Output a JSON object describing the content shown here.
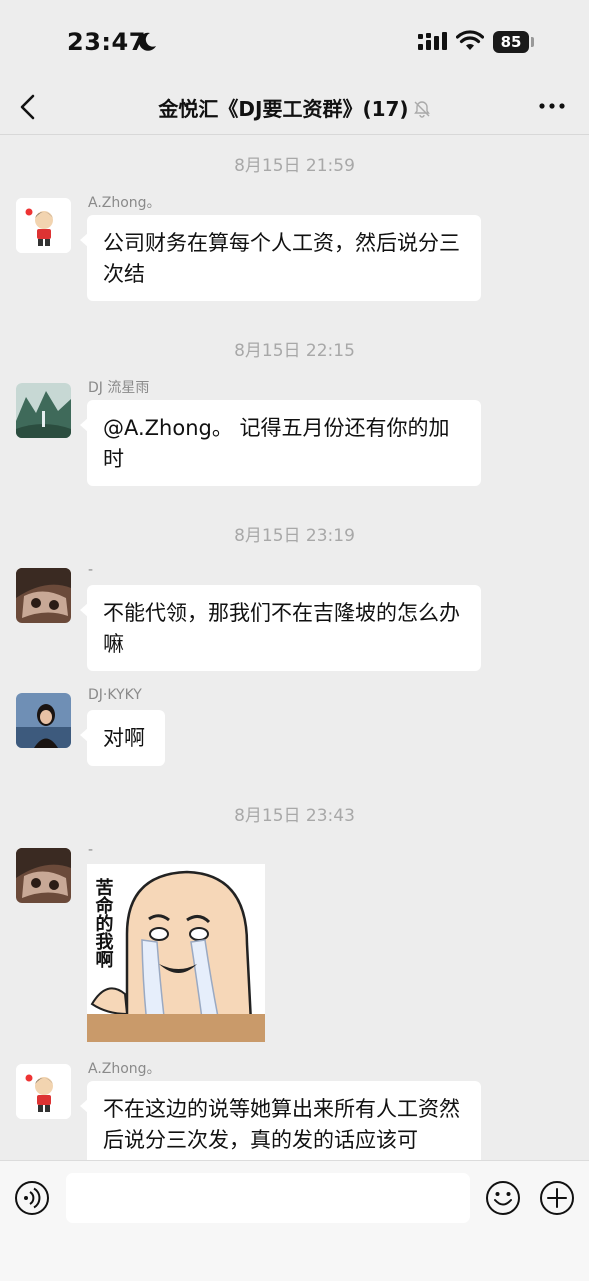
{
  "status_bar": {
    "time": "23:47",
    "battery": "85"
  },
  "header": {
    "title": "金悦汇《DJ要工资群》(17)"
  },
  "messages": [
    {
      "timestamp": "8月15日 21:59",
      "sender": "A.Zhong。",
      "text": "公司财务在算每个人工资，然后说分三次结"
    },
    {
      "timestamp": "8月15日 22:15",
      "sender": "DJ 流星雨",
      "text": "@A.Zhong。 记得五月份还有你的加时"
    },
    {
      "timestamp": "8月15日 23:19",
      "sender": "-",
      "text": "不能代领，那我们不在吉隆坡的怎么办嘛"
    },
    {
      "sender": "DJ·KYKY",
      "text": "对啊"
    },
    {
      "timestamp": "8月15日 23:43",
      "sender": "-",
      "sticker_text": "苦命的我啊"
    },
    {
      "sender": "A.Zhong。",
      "text": "不在这边的说等她算出来所有人工资然后说分三次发，真的发的话应该可"
    }
  ],
  "input_bar": {
    "value": ""
  },
  "colors": {
    "background": "#ededed",
    "bubble": "#ffffff",
    "timestamp": "#a8a8a8"
  }
}
